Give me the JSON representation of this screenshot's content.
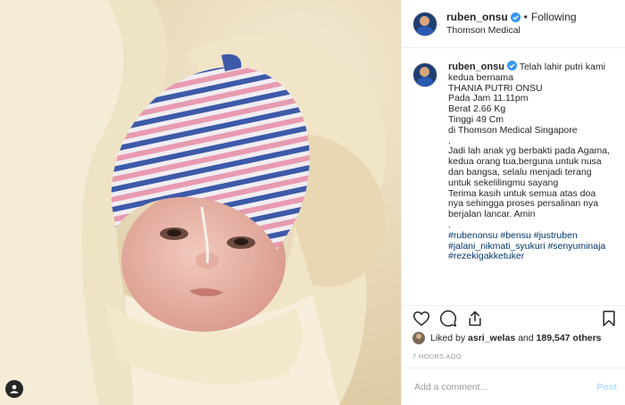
{
  "post": {
    "username": "ruben_onsu",
    "following_label": "Following",
    "location": "Thomson Medical",
    "verified_color": "#3897f0"
  },
  "caption": {
    "username": "ruben_onsu",
    "lines": [
      "Telah lahir putri kami",
      "kedua bernama",
      "THANIA PUTRI ONSU",
      "Pada Jam 11.11pm",
      "Berat 2.66 Kg",
      "Tinggi 49 Cm",
      "di Thomson Medical Singapore",
      ".",
      "Jadi lah anak yg berbakti pada Agama,",
      "kedua orang tua,berguna untuk nusa",
      "dan bangsa, selalu menjadi terang",
      "untuk sekelilingmu sayang",
      "Terima kasih untuk semua atas doa",
      "nya sehingga proses persalinan nya",
      "berjalan lancar. Amin",
      "."
    ],
    "hashtags": [
      "#rubenonsu #bensu #justruben",
      "#jalani_nikmati_syukuri #senyuminaja",
      "#rezekigakketuker"
    ]
  },
  "likes": {
    "prefix": "Liked by",
    "user": "asri_welas",
    "middle": "and",
    "count": "189,547 others"
  },
  "time_ago": "7 HOURS AGO",
  "comment": {
    "placeholder": "Add a comment...",
    "post_label": "Post"
  },
  "icons": {
    "like": "heart-icon",
    "comment": "comment-icon",
    "share": "share-icon",
    "save": "bookmark-icon",
    "tag": "user-tag-icon"
  }
}
